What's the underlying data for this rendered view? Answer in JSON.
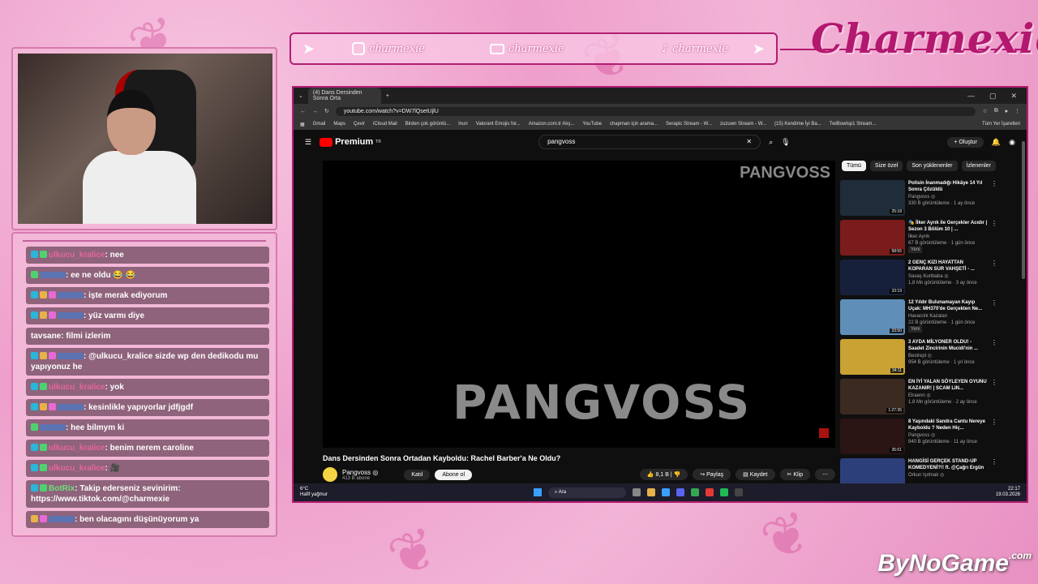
{
  "brand": {
    "name": "Charmexie",
    "watermark": "ByNoGame",
    "watermark_suffix": ".com"
  },
  "social": [
    {
      "icon": "instagram-icon",
      "handle": "charmexie"
    },
    {
      "icon": "youtube-icon",
      "handle": "charmexie"
    },
    {
      "icon": "tiktok-icon",
      "handle": "charmexie"
    }
  ],
  "chat": [
    {
      "user": "ulkucu_kralice",
      "text": ": nee",
      "color": "#e8659b",
      "badges": [
        "b1",
        "b2"
      ]
    },
    {
      "user": "",
      "text": ": ee ne oldu 😂 😂",
      "color": "#3a7fd6",
      "badges": [
        "b2"
      ]
    },
    {
      "user": "",
      "text": ": işte merak ediyorum",
      "color": "#3a7fd6",
      "badges": [
        "b1",
        "b3",
        "b4"
      ]
    },
    {
      "user": "",
      "text": ": yüz varmı diye",
      "color": "#3a7fd6",
      "badges": [
        "b1",
        "b3",
        "b4"
      ]
    },
    {
      "user": "tavsane",
      "text": ": filmi izlerim",
      "color": "#ffffff",
      "badges": []
    },
    {
      "user": "",
      "text": ": @ulkucu_kralice sizde wp den dedikodu mu yapıyonuz he",
      "color": "#3a7fd6",
      "badges": [
        "b1",
        "b3",
        "b4"
      ]
    },
    {
      "user": "ulkucu_kralice",
      "text": ": yok",
      "color": "#e8659b",
      "badges": [
        "b1",
        "b2"
      ]
    },
    {
      "user": "",
      "text": ": kesinlikle yapıyorlar jdfjgdf",
      "color": "#3a7fd6",
      "badges": [
        "b1",
        "b3",
        "b4"
      ]
    },
    {
      "user": "",
      "text": ": hee bilmym ki",
      "color": "#3a7fd6",
      "badges": [
        "b2"
      ]
    },
    {
      "user": "ulkucu_kralice",
      "text": ": benim nerem caroline",
      "color": "#e8659b",
      "badges": [
        "b1",
        "b2"
      ]
    },
    {
      "user": "ulkucu_kralice",
      "text": ": 🎥",
      "color": "#e8659b",
      "badges": [
        "b1",
        "b2"
      ]
    },
    {
      "user": "BotRix",
      "text": ": Takip ederseniz sevinirim: https://www.tiktok.com/@charmexie",
      "color": "#6fe07a",
      "badges": [
        "b1",
        "b2"
      ]
    },
    {
      "user": "",
      "text": ": ben olacagını düşünüyorum ya",
      "color": "#3a7fd6",
      "badges": [
        "b3",
        "b4"
      ]
    }
  ],
  "browser": {
    "tab_title": "(4) Dans Dersinden Sonra Orta",
    "url": "youtube.com/watch?v=DW7lQsetUjlU",
    "bookmarks": [
      "Gmail",
      "Maps",
      "Çevir",
      "iCloud Mail",
      "Birden çok görüntü...",
      "Inun",
      "Valorant Emojis for...",
      "Amazon.com.tr Alış...",
      "YouTube",
      "chapman için arama...",
      "Serapic Stream - W...",
      "zuzuwn Stream - W...",
      "(15) Kendime İyi Ba...",
      "TwiBowlsp1 Stream..."
    ],
    "bookmarks_all": "Tüm Yer İşaretleri"
  },
  "youtube": {
    "logo": "Premium",
    "logo_sup": "TR",
    "search_value": "pangvoss",
    "create_label": "+ Oluştur",
    "player_watermark": "PANGVOSS",
    "player_center_text": "PANGVOSS",
    "video_title": "Dans Dersinden Sonra Ortadan Kayboldu: Rachel Barber'a Ne Oldu?",
    "channel": "Pangvoss ◎",
    "subscribers": "413 B abone",
    "join": "Katıl",
    "subscribe": "Abone ol",
    "likes": "8,1 B",
    "share": "Paylaş",
    "save": "Kaydet",
    "clip": "Klip",
    "chips": [
      "Tümü",
      "Size özel",
      "Son yüklenenler",
      "İzlenenler"
    ],
    "recommendations": [
      {
        "title": "Polisin İnanmadığı Hikâye 14 Yıl Sonra Çözüldü",
        "channel": "Pangvoss ◎",
        "meta": "330 B görüntüleme · 1 ay önce",
        "duration": "25:18",
        "badge": "",
        "thumb_color": "#1f2d3a"
      },
      {
        "title": "🎭 İlker Ayrık ile Gerçekler Acıdır | Sezon 3 Bölüm 10 | ...",
        "channel": "İlker Ayrık",
        "meta": "67 B görüntüleme · 1 gün önce",
        "duration": "58:55",
        "badge": "Yeni",
        "thumb_color": "#7a1c1c"
      },
      {
        "title": "2 GENÇ KIZI HAYATTAN KOPARAN SUR VAHŞETİ - ...",
        "channel": "Savaş Kurtbaba ◎",
        "meta": "1,8 Mn görüntüleme · 3 ay önce",
        "duration": "33:19",
        "badge": "",
        "thumb_color": "#17203b"
      },
      {
        "title": "12 Yıldır Bulunamayan Kayıp Uçak: MH370'de Gerçekten Ne...",
        "channel": "Havacılık Kazaları",
        "meta": "22 B görüntüleme · 1 gün önce",
        "duration": "33:50",
        "badge": "Yeni",
        "thumb_color": "#5f8fb8"
      },
      {
        "title": "3 AYDA MİLYONER OLDU! - Saadet Zincirinin Mucidi'nin ...",
        "channel": "Bestrepl ◎",
        "meta": "954 B görüntüleme · 1 yıl önce",
        "duration": "34:11",
        "badge": "",
        "thumb_color": "#c9a233"
      },
      {
        "title": "EN İYİ YALAN SÖYLEYEN OYUNU KAZANIR! | SCAM LIN...",
        "channel": "Elraenn ◎",
        "meta": "1,8 Mn görüntüleme · 2 ay önce",
        "duration": "1:27:35",
        "badge": "",
        "thumb_color": "#3a2a20"
      },
      {
        "title": "8 Yaşındaki Sandra Cantu Nereye Kayboldu ? Neden Hiç...",
        "channel": "Pangvoss ◎",
        "meta": "940 B görüntüleme · 11 ay önce",
        "duration": "35:01",
        "badge": "",
        "thumb_color": "#2a1414"
      },
      {
        "title": "HANGİSİ GERÇEK STAND-UP KOMEDYENİ?!! ft. @Çağrı Ergün",
        "channel": "Orkun Işıtmak ◎",
        "meta": "",
        "duration": "",
        "badge": "",
        "thumb_color": "#2d3f7a"
      }
    ]
  },
  "taskbar": {
    "weather_temp": "6°C",
    "weather_desc": "Hafif yağmur",
    "search": "Ara",
    "time": "22:17",
    "date": "19.03.2026"
  }
}
